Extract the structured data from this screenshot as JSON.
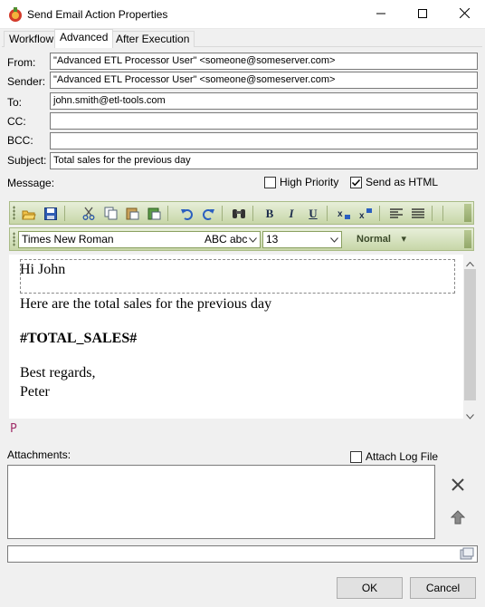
{
  "window": {
    "title": "Send Email Action Properties"
  },
  "tabs": [
    "Workflow",
    "Advanced",
    "After Execution"
  ],
  "fields": {
    "from_label": "From:",
    "from_value": "\"Advanced ETL Processor User\" <someone@someserver.com>",
    "sender_label": "Sender:",
    "sender_value": "\"Advanced ETL Processor User\" <someone@someserver.com>",
    "to_label": "To:",
    "to_value": "john.smith@etl-tools.com",
    "cc_label": "CC:",
    "cc_value": "",
    "bcc_label": "BCC:",
    "bcc_value": "",
    "subject_label": "Subject:",
    "subject_value": "Total sales for the previous day"
  },
  "message": {
    "label": "Message:",
    "high_priority_label": "High Priority",
    "high_priority_checked": false,
    "send_as_html_label": "Send as HTML",
    "send_as_html_checked": true
  },
  "format_toolbar": {
    "font_name": "Times New Roman",
    "font_preview": "ABC abc",
    "font_size": "13",
    "style": "Normal"
  },
  "editor": {
    "lines": [
      "Hi John",
      "Here are the total sales for the previous day",
      "#TOTAL_SALES#",
      "Best regards,",
      "Peter"
    ],
    "status_tag": "P"
  },
  "attachments": {
    "label": "Attachments:",
    "attach_log_label": "Attach Log File",
    "attach_log_checked": false
  },
  "buttons": {
    "ok": "OK",
    "cancel": "Cancel"
  },
  "icons": [
    "app-icon",
    "minimize-icon",
    "maximize-icon",
    "close-icon",
    "open-icon",
    "save-icon",
    "cut-icon",
    "copy-icon",
    "paste-icon",
    "paste-special-icon",
    "undo-icon",
    "redo-icon",
    "find-icon",
    "bold-icon",
    "italic-icon",
    "underline-icon",
    "subscript-icon",
    "superscript-icon",
    "align-left-icon",
    "justify-icon",
    "delete-icon",
    "up-arrow-icon",
    "browse-icon"
  ]
}
